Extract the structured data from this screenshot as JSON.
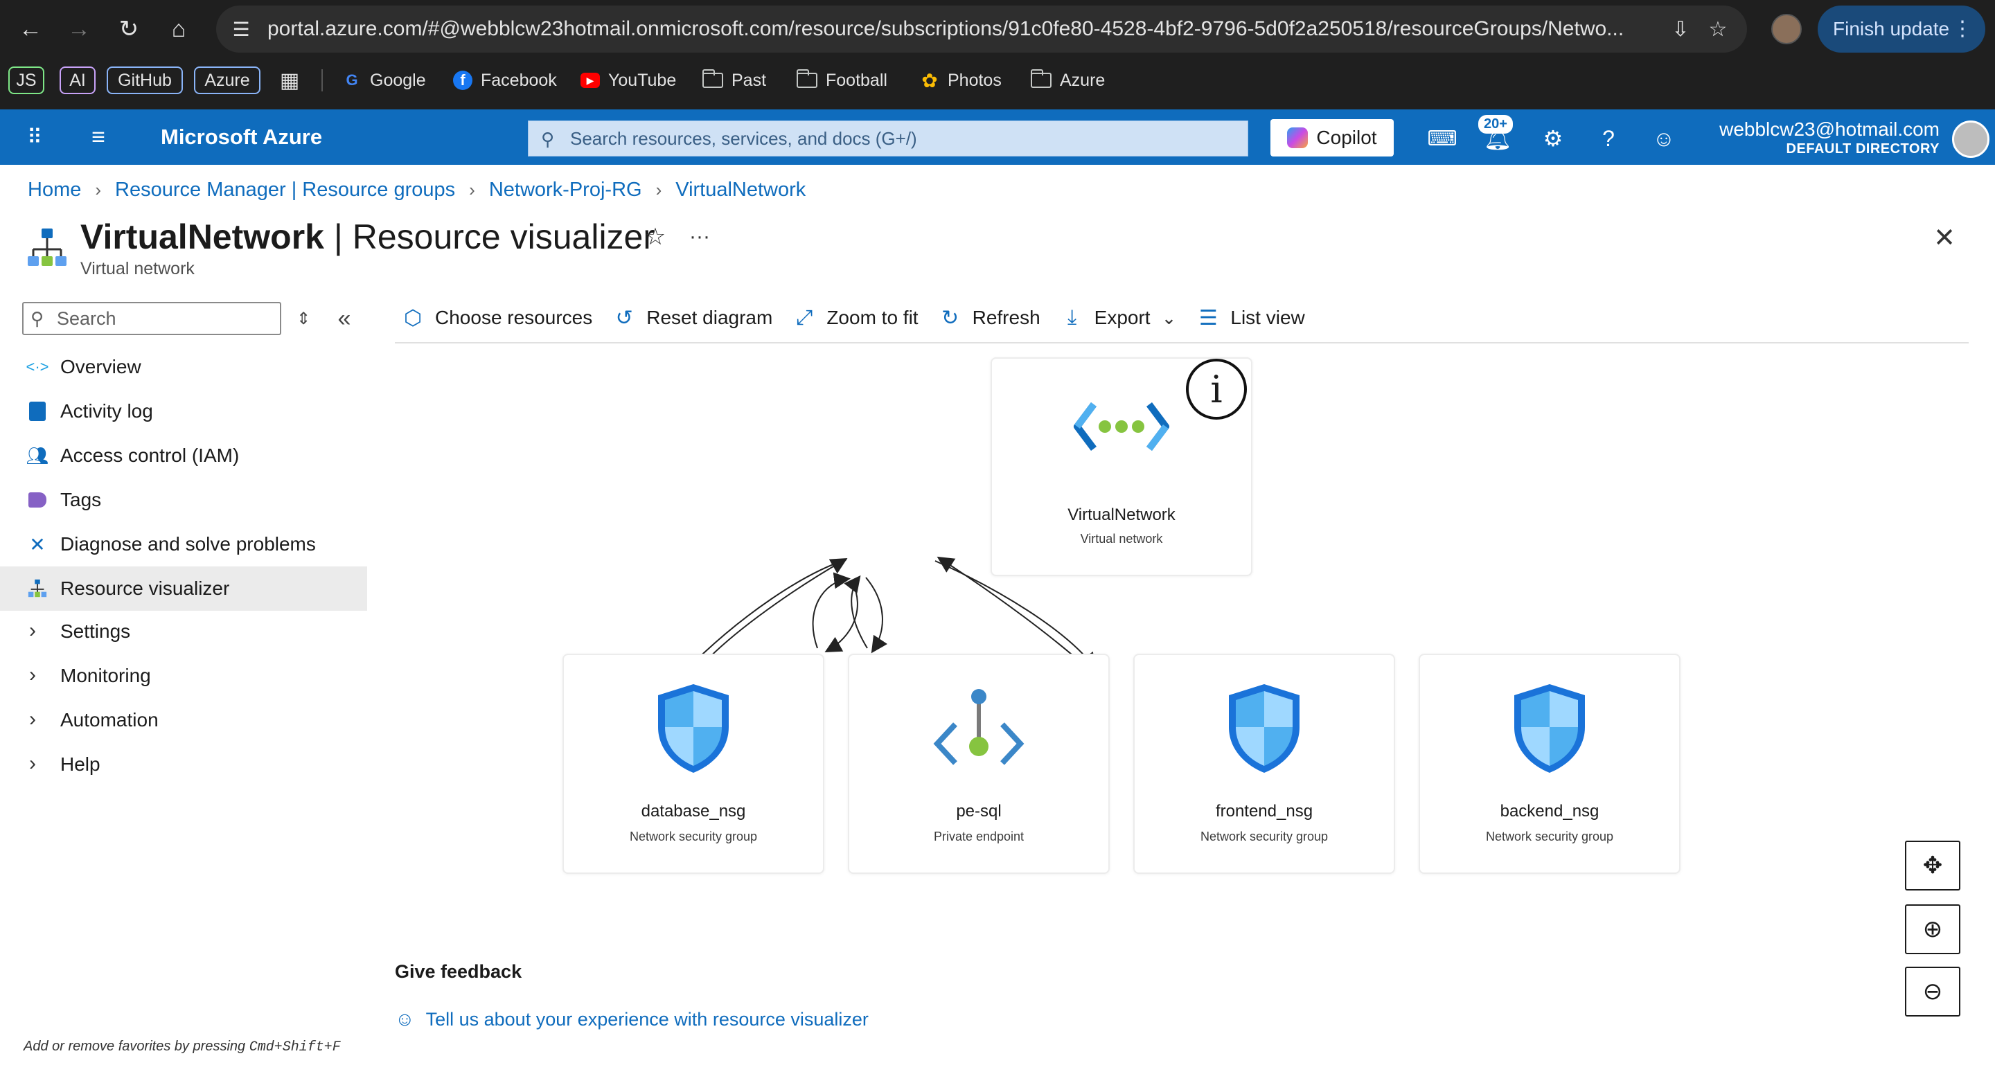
{
  "browser": {
    "url": "portal.azure.com/#@webblcw23hotmail.onmicrosoft.com/resource/subscriptions/91c0fe80-4528-4bf2-9796-5d0f2a250518/resourceGroups/Netwo...",
    "finish_update_label": "Finish update",
    "bookmarks": [
      {
        "label": "JS",
        "kind": "pill",
        "color": "#7ee787"
      },
      {
        "label": "AI",
        "kind": "pill",
        "color": "#c8a2f8"
      },
      {
        "label": "GitHub",
        "kind": "pill",
        "color": "#8ab4f8"
      },
      {
        "label": "Azure",
        "kind": "pill",
        "color": "#8ab4f8"
      },
      {
        "label": "Google",
        "kind": "link",
        "icon": "google-icon"
      },
      {
        "label": "Facebook",
        "kind": "link",
        "icon": "facebook-icon"
      },
      {
        "label": "YouTube",
        "kind": "link",
        "icon": "youtube-icon"
      },
      {
        "label": "Past",
        "kind": "folder",
        "icon": "folder-icon"
      },
      {
        "label": "Football",
        "kind": "folder",
        "icon": "folder-icon"
      },
      {
        "label": "Photos",
        "kind": "link",
        "icon": "photos-icon"
      },
      {
        "label": "Azure",
        "kind": "folder",
        "icon": "folder-icon"
      }
    ]
  },
  "header": {
    "brand": "Microsoft Azure",
    "search_placeholder": "Search resources, services, and docs (G+/)",
    "copilot_label": "Copilot",
    "notification_count": "20+",
    "account_email": "webblcw23@hotmail.com",
    "account_directory": "DEFAULT DIRECTORY",
    "accent_color": "#0f6cbd"
  },
  "breadcrumb": [
    "Home",
    "Resource Manager | Resource groups",
    "Network-Proj-RG",
    "VirtualNetwork"
  ],
  "page": {
    "title_resource": "VirtualNetwork",
    "title_separator": " | ",
    "title_view": "Resource visualizer",
    "subtitle": "Virtual network"
  },
  "sidebar": {
    "search_placeholder": "Search",
    "items": [
      {
        "label": "Overview",
        "icon": "overview-icon"
      },
      {
        "label": "Activity log",
        "icon": "activity-log-icon"
      },
      {
        "label": "Access control (IAM)",
        "icon": "iam-icon"
      },
      {
        "label": "Tags",
        "icon": "tag-icon"
      },
      {
        "label": "Diagnose and solve problems",
        "icon": "wrench-icon"
      },
      {
        "label": "Resource visualizer",
        "icon": "resource-visualizer-icon",
        "active": true
      },
      {
        "label": "Settings",
        "expandable": true
      },
      {
        "label": "Monitoring",
        "expandable": true
      },
      {
        "label": "Automation",
        "expandable": true
      },
      {
        "label": "Help",
        "expandable": true
      }
    ]
  },
  "toolbar": {
    "choose_resources": "Choose resources",
    "reset_diagram": "Reset diagram",
    "zoom_to_fit": "Zoom to fit",
    "refresh": "Refresh",
    "export": "Export",
    "list_view": "List view"
  },
  "diagram": {
    "root": {
      "name": "VirtualNetwork",
      "type": "Virtual network",
      "icon": "virtual-network-icon",
      "info_label": "i"
    },
    "children": [
      {
        "name": "database_nsg",
        "type": "Network security group",
        "icon": "shield-icon"
      },
      {
        "name": "pe-sql",
        "type": "Private endpoint",
        "icon": "private-endpoint-icon"
      },
      {
        "name": "frontend_nsg",
        "type": "Network security group",
        "icon": "shield-icon"
      },
      {
        "name": "backend_nsg",
        "type": "Network security group",
        "icon": "shield-icon"
      }
    ]
  },
  "feedback": {
    "title": "Give feedback",
    "link": "Tell us about your experience with resource visualizer"
  },
  "favorites_hint": "Add or remove favorites by pressing",
  "favorites_shortcut": "Cmd+Shift+F"
}
